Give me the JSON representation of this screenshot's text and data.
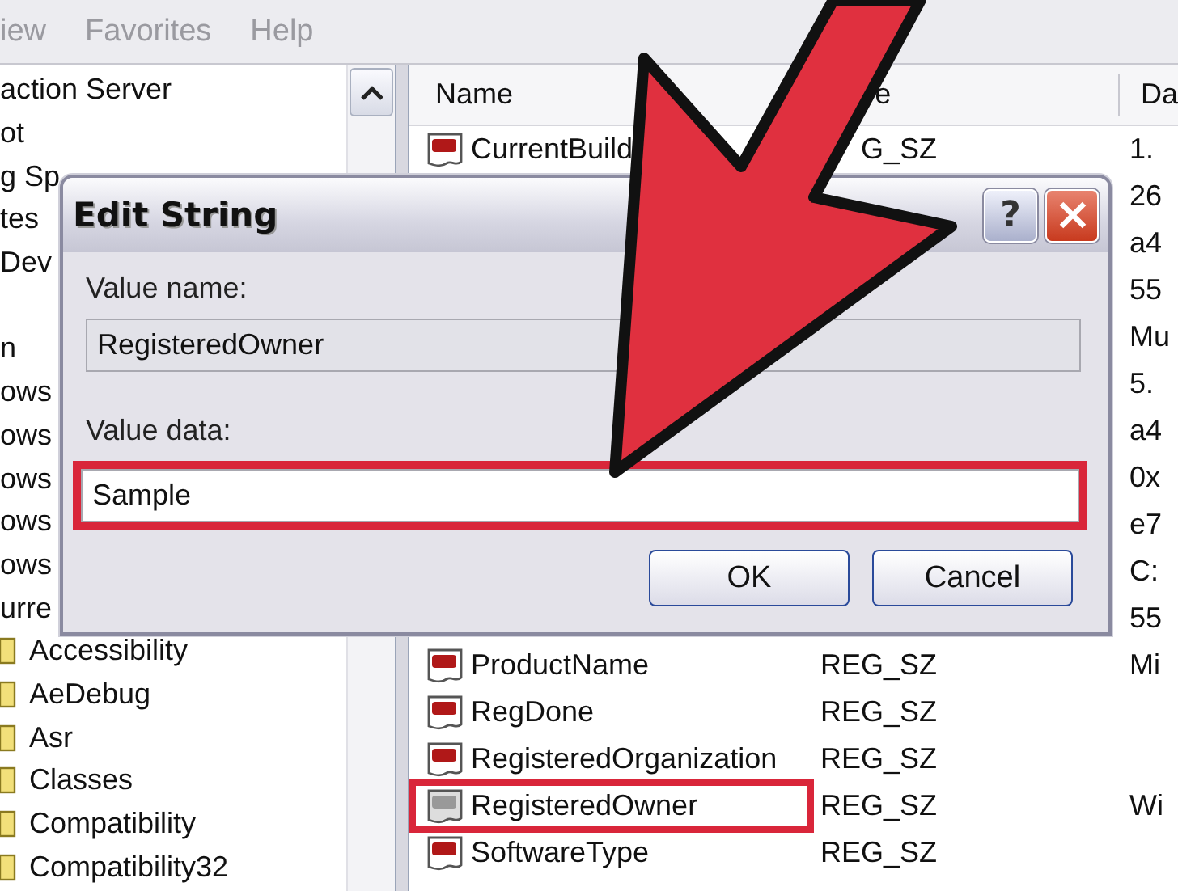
{
  "menu": [
    "iew",
    "Favorites",
    "Help"
  ],
  "tree": {
    "items": [
      {
        "label": "action Server",
        "kind": "plain"
      },
      {
        "label": "ot",
        "kind": "plain"
      },
      {
        "label": "g Sp",
        "kind": "plain"
      },
      {
        "label": "tes",
        "kind": "plain"
      },
      {
        "label": "Dev",
        "kind": "plain"
      },
      {
        "kind": "blank"
      },
      {
        "label": "n",
        "kind": "plain"
      },
      {
        "label": "ows",
        "kind": "plain"
      },
      {
        "label": "ows",
        "kind": "plain"
      },
      {
        "label": "ows",
        "kind": "plain"
      },
      {
        "label": "ows",
        "kind": "plain"
      },
      {
        "label": "ows",
        "kind": "plain"
      },
      {
        "label": "urre",
        "kind": "plain"
      },
      {
        "label": "Accessibility",
        "kind": "folder"
      },
      {
        "label": "AeDebug",
        "kind": "folder"
      },
      {
        "label": "Asr",
        "kind": "folder"
      },
      {
        "label": "Classes",
        "kind": "folder"
      },
      {
        "label": "Compatibility",
        "kind": "folder"
      },
      {
        "label": "Compatibility32",
        "kind": "folder"
      }
    ]
  },
  "list": {
    "columns": [
      "Name",
      "e",
      "Da"
    ],
    "rows": [
      {
        "name": "CurrentBuild",
        "type": "G_SZ",
        "data": "1.",
        "highlighted": false
      },
      {
        "data": "26"
      },
      {
        "data": "a4"
      },
      {
        "data": "55"
      },
      {
        "data": "Mu"
      },
      {
        "data": "5."
      },
      {
        "data": "a4"
      },
      {
        "data": "0x"
      },
      {
        "data": "e7"
      },
      {
        "data": "C:"
      },
      {
        "data": "55"
      },
      {
        "name": "ProductName",
        "type": "REG_SZ",
        "data": "Mi",
        "highlighted": false
      },
      {
        "name": "RegDone",
        "type": "REG_SZ",
        "highlighted": false
      },
      {
        "name": "RegisteredOrganization",
        "type": "REG_SZ",
        "highlighted": false
      },
      {
        "name": "RegisteredOwner",
        "type": "REG_SZ",
        "data": "Wi",
        "highlighted": true
      },
      {
        "name": "SoftwareType",
        "type": "REG_SZ",
        "highlighted": false
      }
    ]
  },
  "dialog": {
    "title": "Edit String",
    "help_button": "?",
    "value_name": {
      "label": "Value name:",
      "value": "RegisteredOwner",
      "disabled": true
    },
    "value_data": {
      "label": "Value data:",
      "value": "Sample",
      "highlighted": true
    },
    "buttons": [
      "OK",
      "Cancel"
    ]
  },
  "annotations": [
    {
      "kind": "arrow"
    }
  ]
}
